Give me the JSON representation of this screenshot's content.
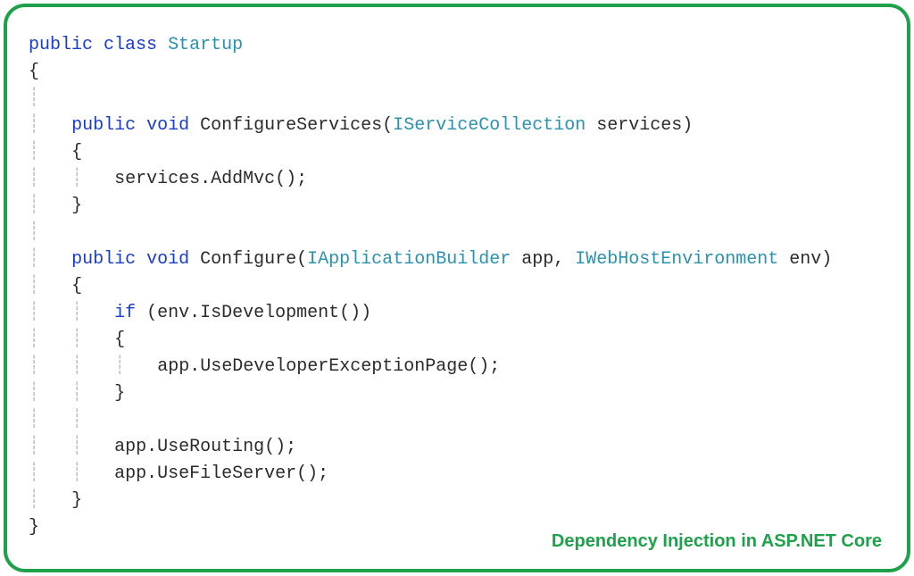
{
  "code": {
    "line1_kw_public": "public",
    "line1_kw_class": "class",
    "line1_classname": "Startup",
    "line2_brace": "{",
    "line4_kw_public": "public",
    "line4_kw_void": "void",
    "line4_method": "ConfigureServices",
    "line4_paren_open": "(",
    "line4_type": "IServiceCollection",
    "line4_param": " services)",
    "line5_brace": "{",
    "line6_stmt": "services.AddMvc();",
    "line7_brace": "}",
    "line9_kw_public": "public",
    "line9_kw_void": "void",
    "line9_method": "Configure",
    "line9_paren_open": "(",
    "line9_type1": "IApplicationBuilder",
    "line9_param1": " app, ",
    "line9_type2": "IWebHostEnvironment",
    "line9_param2": " env)",
    "line10_brace": "{",
    "line11_kw_if": "if",
    "line11_cond": " (env.IsDevelopment())",
    "line12_brace": "{",
    "line13_stmt": "app.UseDeveloperExceptionPage();",
    "line14_brace": "}",
    "line16_stmt": "app.UseRouting();",
    "line17_stmt": "app.UseFileServer();",
    "line18_brace": "}",
    "line19_brace": "}"
  },
  "footer": "Dependency Injection in ASP.NET Core"
}
